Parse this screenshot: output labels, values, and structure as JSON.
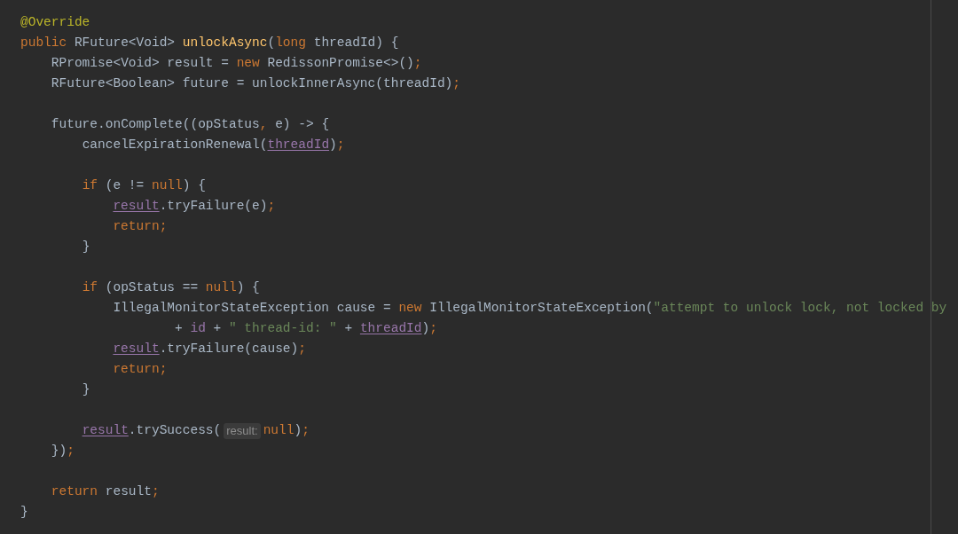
{
  "editor": {
    "lines": [
      {
        "kind": "code",
        "tokens": [
          {
            "text": "@Override",
            "kind": "annotation"
          }
        ]
      },
      {
        "kind": "code",
        "tokens": [
          {
            "text": "public ",
            "kind": "keyword"
          },
          {
            "text": "RFuture<Void> ",
            "kind": "plain"
          },
          {
            "text": "unlockAsync",
            "kind": "method"
          },
          {
            "text": "(",
            "kind": "plain"
          },
          {
            "text": "long ",
            "kind": "keyword"
          },
          {
            "text": "threadId) {",
            "kind": "plain"
          }
        ]
      },
      {
        "kind": "code",
        "tokens": [
          {
            "text": "    RPromise<Void> result = ",
            "kind": "plain"
          },
          {
            "text": "new ",
            "kind": "keyword"
          },
          {
            "text": "RedissonPromise<>()",
            "kind": "plain"
          },
          {
            "text": ";",
            "kind": "keyword"
          }
        ]
      },
      {
        "kind": "code",
        "tokens": [
          {
            "text": "    RFuture<Boolean> future = unlockInnerAsync(threadId)",
            "kind": "plain"
          },
          {
            "text": ";",
            "kind": "keyword"
          }
        ]
      },
      {
        "kind": "blank"
      },
      {
        "kind": "code",
        "tokens": [
          {
            "text": "    future.onComplete((opStatus",
            "kind": "plain"
          },
          {
            "text": ",",
            "kind": "keyword"
          },
          {
            "text": " e) -> {",
            "kind": "plain"
          }
        ]
      },
      {
        "kind": "code",
        "tokens": [
          {
            "text": "        cancelExpirationRenewal(",
            "kind": "plain"
          },
          {
            "text": "threadId",
            "kind": "field"
          },
          {
            "text": ")",
            "kind": "plain"
          },
          {
            "text": ";",
            "kind": "keyword"
          }
        ]
      },
      {
        "kind": "blank"
      },
      {
        "kind": "code",
        "tokens": [
          {
            "text": "        if ",
            "kind": "keyword"
          },
          {
            "text": "(e != ",
            "kind": "plain"
          },
          {
            "text": "null",
            "kind": "keyword"
          },
          {
            "text": ") {",
            "kind": "plain"
          }
        ]
      },
      {
        "kind": "code",
        "tokens": [
          {
            "text": "            result",
            "kind": "field"
          },
          {
            "text": ".tryFailure(e)",
            "kind": "plain"
          },
          {
            "text": ";",
            "kind": "keyword"
          }
        ]
      },
      {
        "kind": "code",
        "tokens": [
          {
            "text": "            return;",
            "kind": "keyword"
          }
        ]
      },
      {
        "kind": "code",
        "tokens": [
          {
            "text": "        }",
            "kind": "plain"
          }
        ]
      },
      {
        "kind": "blank"
      },
      {
        "kind": "code",
        "tokens": [
          {
            "text": "        if ",
            "kind": "keyword"
          },
          {
            "text": "(opStatus == ",
            "kind": "plain"
          },
          {
            "text": "null",
            "kind": "keyword"
          },
          {
            "text": ") {",
            "kind": "plain"
          }
        ]
      },
      {
        "kind": "code",
        "tokens": [
          {
            "text": "            IllegalMonitorStateException cause = ",
            "kind": "plain"
          },
          {
            "text": "new ",
            "kind": "keyword"
          },
          {
            "text": "IllegalMonitorStateException(",
            "kind": "plain"
          },
          {
            "text": "\"attempt to unlock lock, not locked by",
            "kind": "string"
          }
        ]
      },
      {
        "kind": "code",
        "tokens": [
          {
            "text": "                    + ",
            "kind": "plain"
          },
          {
            "text": "id",
            "kind": "field_plain"
          },
          {
            "text": " + ",
            "kind": "plain"
          },
          {
            "text": "\" thread-id: \"",
            "kind": "string"
          },
          {
            "text": " + ",
            "kind": "plain"
          },
          {
            "text": "threadId",
            "kind": "field"
          },
          {
            "text": ")",
            "kind": "plain"
          },
          {
            "text": ";",
            "kind": "keyword"
          }
        ]
      },
      {
        "kind": "code",
        "tokens": [
          {
            "text": "            result",
            "kind": "field"
          },
          {
            "text": ".tryFailure(cause)",
            "kind": "plain"
          },
          {
            "text": ";",
            "kind": "keyword"
          }
        ]
      },
      {
        "kind": "code",
        "tokens": [
          {
            "text": "            return;",
            "kind": "keyword"
          }
        ]
      },
      {
        "kind": "code",
        "tokens": [
          {
            "text": "        }",
            "kind": "plain"
          }
        ]
      },
      {
        "kind": "blank"
      },
      {
        "kind": "code",
        "tokens": [
          {
            "text": "        result",
            "kind": "field"
          },
          {
            "text": ".trySuccess(",
            "kind": "plain"
          },
          {
            "text": "result:",
            "kind": "hint"
          },
          {
            "text": "null",
            "kind": "keyword"
          },
          {
            "text": ")",
            "kind": "plain"
          },
          {
            "text": ";",
            "kind": "keyword"
          }
        ]
      },
      {
        "kind": "code",
        "tokens": [
          {
            "text": "    })",
            "kind": "plain"
          },
          {
            "text": ";",
            "kind": "keyword"
          }
        ]
      },
      {
        "kind": "blank"
      },
      {
        "kind": "code",
        "tokens": [
          {
            "text": "    return ",
            "kind": "keyword"
          },
          {
            "text": "result",
            "kind": "plain"
          },
          {
            "text": ";",
            "kind": "keyword"
          }
        ]
      },
      {
        "kind": "code",
        "tokens": [
          {
            "text": "}",
            "kind": "plain"
          }
        ]
      }
    ]
  }
}
